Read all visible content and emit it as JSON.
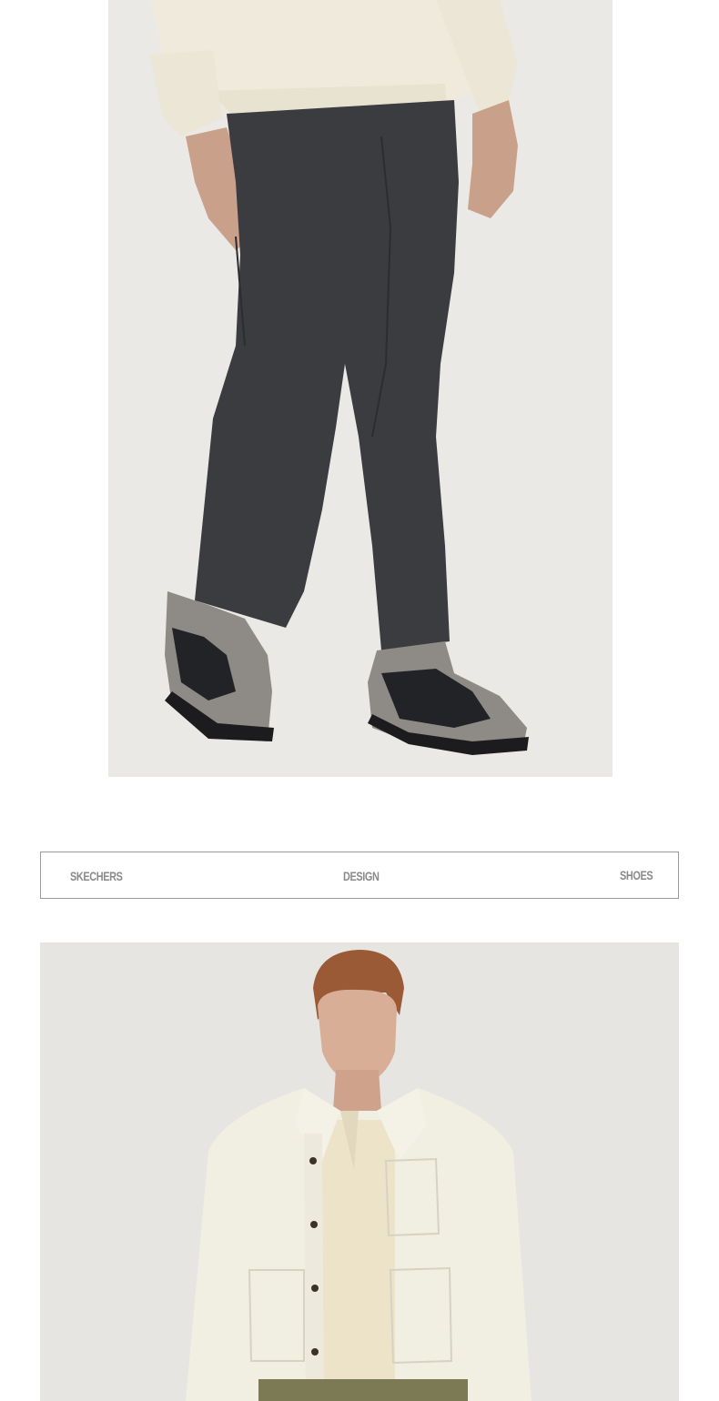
{
  "banner": {
    "left_text": "SKECHERS",
    "center_text": "DESIGN",
    "right_text": "SHOES"
  },
  "photos": {
    "top": {
      "subject": "model wearing dark grey trousers, cream sweatshirt and grey sneakers"
    },
    "bottom": {
      "subject": "model wearing cream button-up jacket over cream knit"
    }
  },
  "colors": {
    "background": "#ffffff",
    "photo_bg": "#eceae6",
    "trousers": "#3a3b3f",
    "sweatshirt": "#efeadb",
    "banner_border": "#9a9a9a",
    "banner_text": "#8a8a8a"
  }
}
